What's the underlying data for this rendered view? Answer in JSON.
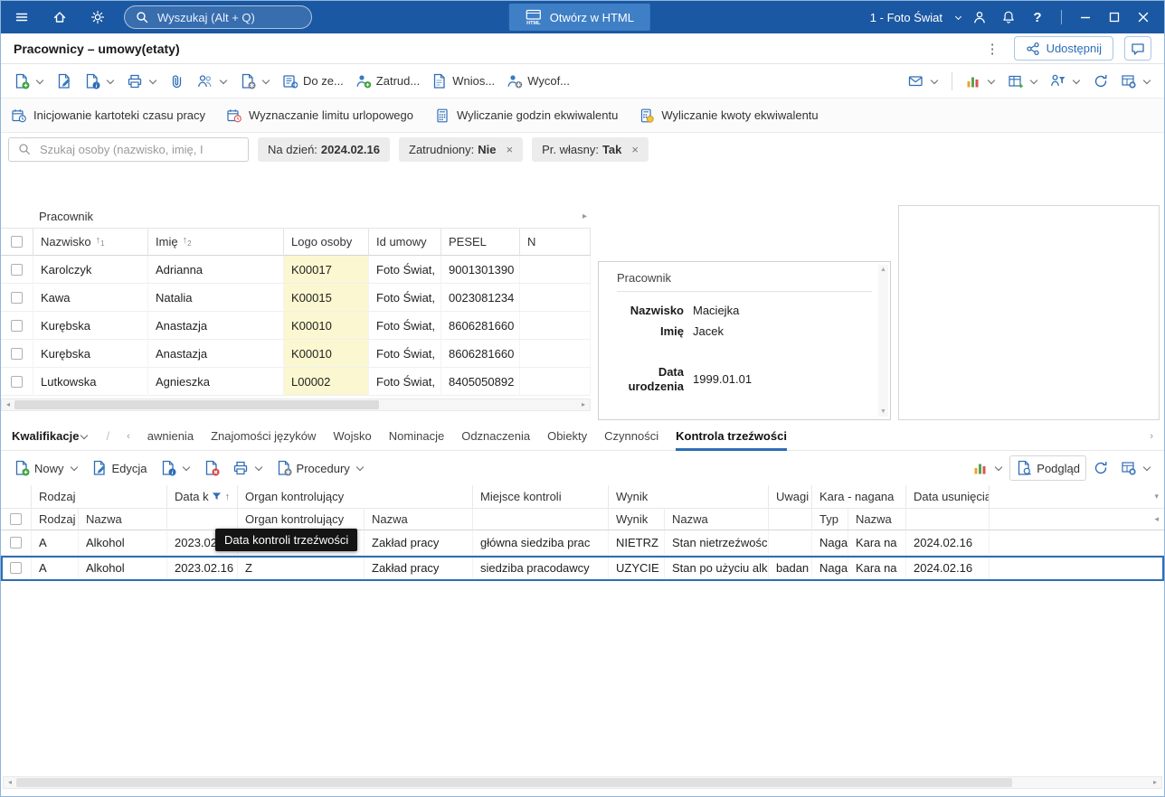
{
  "topbar": {
    "search_placeholder": "Wyszukaj (Alt + Q)",
    "open_html_label": "Otwórz w HTML",
    "company": "1 - Foto Świat"
  },
  "titlebar": {
    "title": "Pracownicy – umowy(etaty)",
    "share_label": "Udostępnij"
  },
  "toolbar": {
    "do_zespolu": "Do ze...",
    "zatrudnij": "Zatrud...",
    "wniosek": "Wnios...",
    "wycofaj": "Wycof..."
  },
  "operations": {
    "items": [
      "Inicjowanie kartoteki czasu pracy",
      "Wyznaczanie limitu urlopowego",
      "Wyliczanie godzin ekwiwalentu",
      "Wyliczanie kwoty ekwiwalentu"
    ]
  },
  "filters": {
    "search_placeholder": "Szukaj osoby (nazwisko, imię, I",
    "chips": [
      {
        "label": "Na dzień:",
        "value": "2024.02.16"
      },
      {
        "label": "Zatrudniony:",
        "value": "Nie"
      },
      {
        "label": "Pr. własny:",
        "value": "Tak"
      }
    ]
  },
  "employees": {
    "band": "Pracownik",
    "columns": [
      {
        "label": "Nazwisko",
        "sort": "1"
      },
      {
        "label": "Imię",
        "sort": "2"
      },
      {
        "label": "Logo osoby"
      },
      {
        "label": "Id umowy"
      },
      {
        "label": "PESEL"
      },
      {
        "label": "N"
      }
    ],
    "rows": [
      {
        "nazwisko": "Karolczyk",
        "imie": "Adrianna",
        "logo": "K00017",
        "id_umowy": "Foto Świat,",
        "pesel": "9001301390"
      },
      {
        "nazwisko": "Kawa",
        "imie": "Natalia",
        "logo": "K00015",
        "id_umowy": "Foto Świat,",
        "pesel": "0023081234"
      },
      {
        "nazwisko": "Kurębska",
        "imie": "Anastazja",
        "logo": "K00010",
        "id_umowy": "Foto Świat,",
        "pesel": "8606281660"
      },
      {
        "nazwisko": "Kurębska",
        "imie": "Anastazja",
        "logo": "K00010",
        "id_umowy": "Foto Świat,",
        "pesel": "8606281660"
      },
      {
        "nazwisko": "Lutkowska",
        "imie": "Agnieszka",
        "logo": "L00002",
        "id_umowy": "Foto Świat,",
        "pesel": "8405050892"
      }
    ]
  },
  "detail": {
    "title": "Pracownik",
    "fields": [
      {
        "label": "Nazwisko",
        "value": "Maciejka"
      },
      {
        "label": "Imię",
        "value": "Jacek"
      },
      {
        "label": "Data urodzenia",
        "value": "1999.01.01"
      }
    ]
  },
  "tabs": {
    "group": "Kwalifikacje",
    "separator": "/",
    "items": [
      "awnienia",
      "Znajomości języków",
      "Wojsko",
      "Nominacje",
      "Odznaczenia",
      "Obiekty",
      "Czynności",
      "Kontrola trzeźwości"
    ],
    "active": "Kontrola trzeźwości"
  },
  "subtoolbar": {
    "new": "Nowy",
    "edit": "Edycja",
    "procedures": "Procedury",
    "preview": "Podgląd"
  },
  "sobriety": {
    "bands": [
      {
        "label": "Rodzaj"
      },
      {
        "label": "Data k"
      },
      {
        "label": "Organ kontrolujący"
      },
      {
        "label": "Miejsce kontroli"
      },
      {
        "label": "Wynik"
      },
      {
        "label": "Uwagi"
      },
      {
        "label": "Kara - nagana"
      },
      {
        "label": "Data usunięcia"
      }
    ],
    "subcolumns": [
      "Rodzaj",
      "Nazwa",
      "Organ kontrolujący",
      "Nazwa",
      "Wynik",
      "Nazwa",
      "Typ",
      "Nazwa"
    ],
    "rows": [
      {
        "rodzaj": "A",
        "rodzaj_nazwa": "Alkohol",
        "data": "2023.02.16",
        "organ": "",
        "organ_nazwa": "Zakład pracy",
        "miejsce": "główna siedziba prac",
        "wynik": "NIETRZ",
        "wynik_nazwa": "Stan nietrzeźwośc",
        "uwagi": "",
        "kara_typ": "Naga",
        "kara_nazwa": "Kara na",
        "usunieto": "2024.02.16"
      },
      {
        "rodzaj": "A",
        "rodzaj_nazwa": "Alkohol",
        "data": "2023.02.16",
        "organ": "Z",
        "organ_nazwa": "Zakład pracy",
        "miejsce": "siedziba pracodawcy",
        "wynik": "UZYCIE",
        "wynik_nazwa": "Stan po użyciu alk",
        "uwagi": "badan",
        "kara_typ": "Naga",
        "kara_nazwa": "Kara na",
        "usunieto": "2024.02.16"
      }
    ],
    "tooltip": "Data kontroli trzeźwości"
  }
}
